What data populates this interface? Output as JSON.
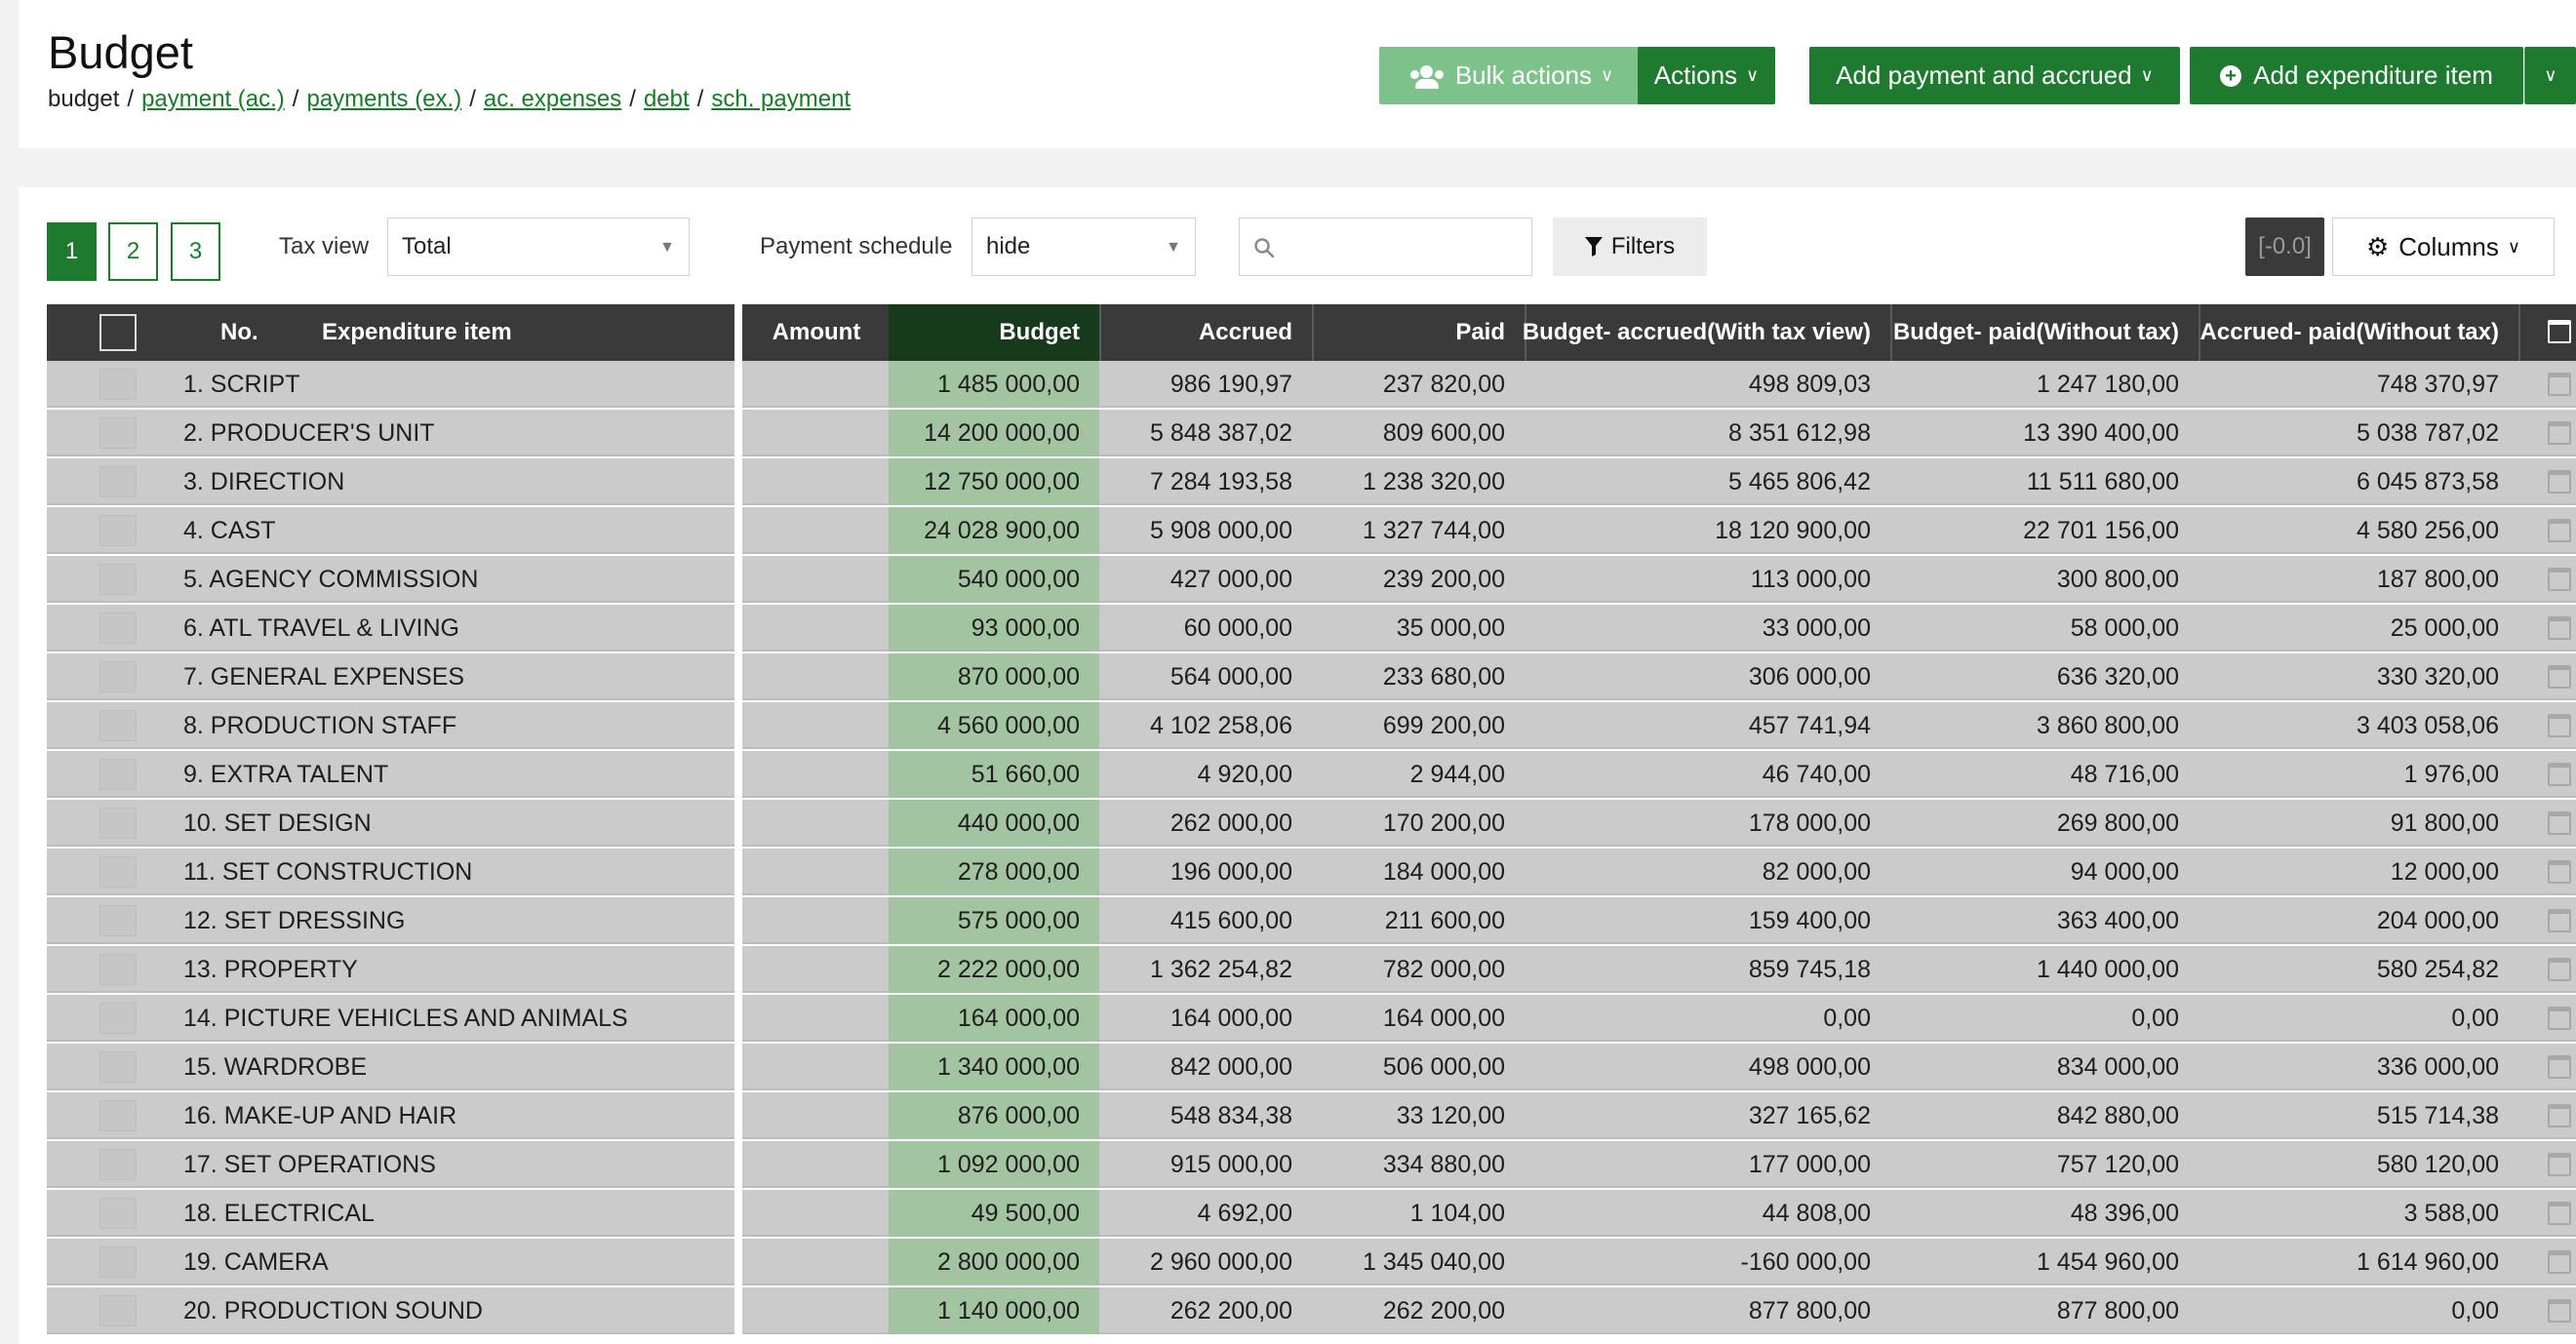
{
  "header": {
    "title": "Budget",
    "breadcrumb": {
      "current": "budget",
      "links": [
        "payment (ac.)",
        "payments (ex.)",
        "ac. expenses",
        "debt",
        "sch. payment"
      ]
    },
    "buttons": {
      "bulk_actions": "Bulk actions",
      "actions": "Actions",
      "add_payment": "Add payment and accrued",
      "add_expenditure": "Add expenditure item"
    }
  },
  "toolbar": {
    "pages": [
      "1",
      "2",
      "3"
    ],
    "active_page": "1",
    "tax_view_label": "Tax view",
    "tax_view_value": "Total",
    "payment_schedule_label": "Payment schedule",
    "payment_schedule_value": "hide",
    "search_value": "",
    "filters_label": "Filters",
    "zoom_label": "[-0.0]",
    "columns_label": "Columns"
  },
  "table": {
    "columns": {
      "no": "No.",
      "item": "Expenditure item",
      "amount": "Amount",
      "budget": "Budget",
      "accrued": "Accrued",
      "paid": "Paid",
      "budget_accrued": "Budget- accrued(With tax view)",
      "budget_paid": "Budget- paid(Without tax)",
      "accrued_paid": "Accrued- paid(Without tax)"
    },
    "rows": [
      {
        "name": "1. SCRIPT",
        "budget": "1 485 000,00",
        "accrued": "986 190,97",
        "paid": "237 820,00",
        "ba": "498 809,03",
        "bp": "1 247 180,00",
        "ap": "748 370,97"
      },
      {
        "name": "2. PRODUCER'S UNIT",
        "budget": "14 200 000,00",
        "accrued": "5 848 387,02",
        "paid": "809 600,00",
        "ba": "8 351 612,98",
        "bp": "13 390 400,00",
        "ap": "5 038 787,02"
      },
      {
        "name": "3. DIRECTION",
        "budget": "12 750 000,00",
        "accrued": "7 284 193,58",
        "paid": "1 238 320,00",
        "ba": "5 465 806,42",
        "bp": "11 511 680,00",
        "ap": "6 045 873,58"
      },
      {
        "name": "4. CAST",
        "budget": "24 028 900,00",
        "accrued": "5 908 000,00",
        "paid": "1 327 744,00",
        "ba": "18 120 900,00",
        "bp": "22 701 156,00",
        "ap": "4 580 256,00"
      },
      {
        "name": "5. AGENCY COMMISSION",
        "budget": "540 000,00",
        "accrued": "427 000,00",
        "paid": "239 200,00",
        "ba": "113 000,00",
        "bp": "300 800,00",
        "ap": "187 800,00"
      },
      {
        "name": "6. ATL TRAVEL & LIVING",
        "budget": "93 000,00",
        "accrued": "60 000,00",
        "paid": "35 000,00",
        "ba": "33 000,00",
        "bp": "58 000,00",
        "ap": "25 000,00"
      },
      {
        "name": "7. GENERAL EXPENSES",
        "budget": "870 000,00",
        "accrued": "564 000,00",
        "paid": "233 680,00",
        "ba": "306 000,00",
        "bp": "636 320,00",
        "ap": "330 320,00"
      },
      {
        "name": "8. PRODUCTION STAFF",
        "budget": "4 560 000,00",
        "accrued": "4 102 258,06",
        "paid": "699 200,00",
        "ba": "457 741,94",
        "bp": "3 860 800,00",
        "ap": "3 403 058,06"
      },
      {
        "name": "9. EXTRA TALENT",
        "budget": "51 660,00",
        "accrued": "4 920,00",
        "paid": "2 944,00",
        "ba": "46 740,00",
        "bp": "48 716,00",
        "ap": "1 976,00"
      },
      {
        "name": "10. SET DESIGN",
        "budget": "440 000,00",
        "accrued": "262 000,00",
        "paid": "170 200,00",
        "ba": "178 000,00",
        "bp": "269 800,00",
        "ap": "91 800,00"
      },
      {
        "name": "11. SET CONSTRUCTION",
        "budget": "278 000,00",
        "accrued": "196 000,00",
        "paid": "184 000,00",
        "ba": "82 000,00",
        "bp": "94 000,00",
        "ap": "12 000,00"
      },
      {
        "name": "12. SET DRESSING",
        "budget": "575 000,00",
        "accrued": "415 600,00",
        "paid": "211 600,00",
        "ba": "159 400,00",
        "bp": "363 400,00",
        "ap": "204 000,00"
      },
      {
        "name": "13. PROPERTY",
        "budget": "2 222 000,00",
        "accrued": "1 362 254,82",
        "paid": "782 000,00",
        "ba": "859 745,18",
        "bp": "1 440 000,00",
        "ap": "580 254,82"
      },
      {
        "name": "14. PICTURE VEHICLES AND ANIMALS",
        "budget": "164 000,00",
        "accrued": "164 000,00",
        "paid": "164 000,00",
        "ba": "0,00",
        "bp": "0,00",
        "ap": "0,00"
      },
      {
        "name": "15. WARDROBE",
        "budget": "1 340 000,00",
        "accrued": "842 000,00",
        "paid": "506 000,00",
        "ba": "498 000,00",
        "bp": "834 000,00",
        "ap": "336 000,00"
      },
      {
        "name": "16. MAKE-UP AND HAIR",
        "budget": "876 000,00",
        "accrued": "548 834,38",
        "paid": "33 120,00",
        "ba": "327 165,62",
        "bp": "842 880,00",
        "ap": "515 714,38"
      },
      {
        "name": "17. SET OPERATIONS",
        "budget": "1 092 000,00",
        "accrued": "915 000,00",
        "paid": "334 880,00",
        "ba": "177 000,00",
        "bp": "757 120,00",
        "ap": "580 120,00"
      },
      {
        "name": "18. ELECTRICAL",
        "budget": "49 500,00",
        "accrued": "4 692,00",
        "paid": "1 104,00",
        "ba": "44 808,00",
        "bp": "48 396,00",
        "ap": "3 588,00"
      },
      {
        "name": "19. CAMERA",
        "budget": "2 800 000,00",
        "accrued": "2 960 000,00",
        "paid": "1 345 040,00",
        "ba": "-160 000,00",
        "bp": "1 454 960,00",
        "ap": "1 614 960,00"
      },
      {
        "name": "20. PRODUCTION SOUND",
        "budget": "1 140 000,00",
        "accrued": "262 200,00",
        "paid": "262 200,00",
        "ba": "877 800,00",
        "bp": "877 800,00",
        "ap": "0,00"
      }
    ]
  },
  "colors": {
    "brand_green": "#1e7a2e",
    "light_green": "#7cc28a",
    "budget_column": "#a3c4a1",
    "header_dark": "#3a3a3a"
  },
  "icons": {
    "bulk_actions": "users-icon",
    "add_expenditure": "plus-circle-icon",
    "filters": "funnel-icon",
    "columns": "gear-icon",
    "search": "search-icon",
    "calendar": "calendar-icon"
  }
}
